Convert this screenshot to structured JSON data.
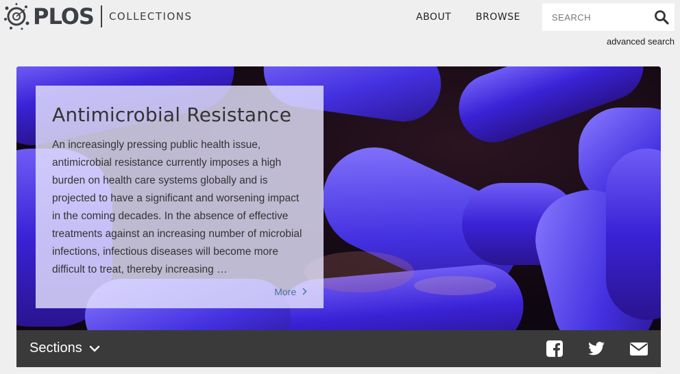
{
  "header": {
    "logo_text": "PLOS",
    "logo_sub": "COLLECTIONS",
    "nav": [
      {
        "label": "ABOUT"
      },
      {
        "label": "BROWSE"
      }
    ],
    "search": {
      "placeholder": "SEARCH",
      "value": ""
    },
    "advanced_search": "advanced search"
  },
  "hero": {
    "title": "Antimicrobial Resistance",
    "description": "An increasingly pressing public health issue, antimicrobial resistance currently imposes a high burden on health care systems globally and is projected to have a significant and worsening impact in the coming decades. In the absence of effective treatments against an increasing number of microbial infections, infectious diseases will become more difficult to treat, thereby increasing …",
    "more_label": "More",
    "more_icon": "chevron-right-icon"
  },
  "sections_bar": {
    "label": "Sections",
    "icon": "chevron-down-icon",
    "share": [
      "facebook-icon",
      "twitter-icon",
      "mail-icon"
    ]
  },
  "colors": {
    "background": "#efefef",
    "text": "#333333",
    "link": "#4a6fa5",
    "bar": "#3a3a3a",
    "card": "#e4e2fc"
  }
}
